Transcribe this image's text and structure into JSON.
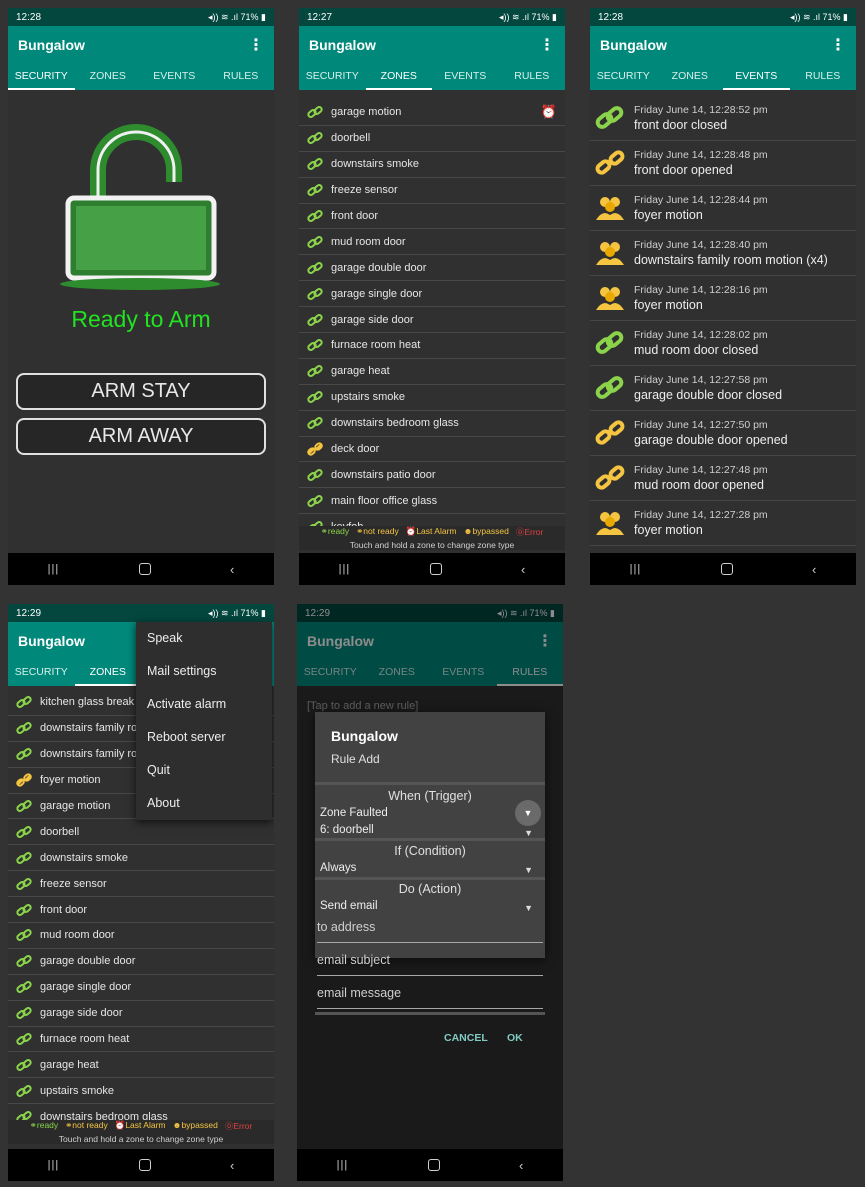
{
  "app_title": "Bungalow",
  "tabs": [
    "SECURITY",
    "ZONES",
    "EVENTS",
    "RULES"
  ],
  "screen1": {
    "time": "12:28",
    "battery": "71%",
    "status": "Ready to Arm",
    "arm_stay": "ARM STAY",
    "arm_away": "ARM AWAY"
  },
  "screen2": {
    "time": "12:27",
    "battery": "71%",
    "zones": [
      {
        "name": "garage motion",
        "state": "ready",
        "alarm": true
      },
      {
        "name": "doorbell",
        "state": "ready"
      },
      {
        "name": "downstairs smoke",
        "state": "ready"
      },
      {
        "name": "freeze sensor",
        "state": "ready"
      },
      {
        "name": "front door",
        "state": "ready"
      },
      {
        "name": "mud room door",
        "state": "ready"
      },
      {
        "name": "garage double door",
        "state": "ready"
      },
      {
        "name": "garage single door",
        "state": "ready"
      },
      {
        "name": "garage side door",
        "state": "ready"
      },
      {
        "name": "furnace room heat",
        "state": "ready"
      },
      {
        "name": "garage heat",
        "state": "ready"
      },
      {
        "name": "upstairs smoke",
        "state": "ready"
      },
      {
        "name": "downstairs bedroom glass",
        "state": "ready"
      },
      {
        "name": "deck door",
        "state": "not_ready"
      },
      {
        "name": "downstairs patio door",
        "state": "ready"
      },
      {
        "name": "main floor office glass",
        "state": "ready"
      },
      {
        "name": "keyfob",
        "state": "ready"
      }
    ]
  },
  "legend": {
    "ready": "ready",
    "not_ready": "not ready",
    "last_alarm": "Last Alarm",
    "bypassed": "bypassed",
    "error": "Error",
    "hint": "Touch and hold a zone to change zone type"
  },
  "screen3": {
    "time": "12:28",
    "battery": "71%",
    "events": [
      {
        "time": "Friday June 14, 12:28:52 pm",
        "text": "front door closed",
        "icon": "link-green"
      },
      {
        "time": "Friday June 14, 12:28:48 pm",
        "text": "front door opened",
        "icon": "link-broken-yellow"
      },
      {
        "time": "Friday June 14, 12:28:44 pm",
        "text": "foyer motion",
        "icon": "people-yellow"
      },
      {
        "time": "Friday June 14, 12:28:40 pm",
        "text": "downstairs family room motion (x4)",
        "icon": "people-yellow"
      },
      {
        "time": "Friday June 14, 12:28:16 pm",
        "text": "foyer motion",
        "icon": "people-yellow"
      },
      {
        "time": "Friday June 14, 12:28:02 pm",
        "text": "mud room door closed",
        "icon": "link-green"
      },
      {
        "time": "Friday June 14, 12:27:58 pm",
        "text": "garage double door closed",
        "icon": "link-green"
      },
      {
        "time": "Friday June 14, 12:27:50 pm",
        "text": "garage double door opened",
        "icon": "link-broken-yellow"
      },
      {
        "time": "Friday June 14, 12:27:48 pm",
        "text": "mud room door opened",
        "icon": "link-broken-yellow"
      },
      {
        "time": "Friday June 14, 12:27:28 pm",
        "text": "foyer motion",
        "icon": "people-yellow"
      }
    ]
  },
  "screen4": {
    "time": "12:29",
    "battery": "71%",
    "menu": [
      "Speak",
      "Mail settings",
      "Activate alarm",
      "Reboot server",
      "Quit",
      "About"
    ],
    "zones": [
      {
        "name": "kitchen glass break",
        "state": "ready"
      },
      {
        "name": "downstairs family ro",
        "state": "ready"
      },
      {
        "name": "downstairs family ro",
        "state": "ready"
      },
      {
        "name": "foyer motion",
        "state": "not_ready"
      },
      {
        "name": "garage motion",
        "state": "ready"
      },
      {
        "name": "doorbell",
        "state": "ready"
      },
      {
        "name": "downstairs smoke",
        "state": "ready"
      },
      {
        "name": "freeze sensor",
        "state": "ready"
      },
      {
        "name": "front door",
        "state": "ready"
      },
      {
        "name": "mud room door",
        "state": "ready"
      },
      {
        "name": "garage double door",
        "state": "ready"
      },
      {
        "name": "garage single door",
        "state": "ready"
      },
      {
        "name": "garage side door",
        "state": "ready"
      },
      {
        "name": "furnace room heat",
        "state": "ready"
      },
      {
        "name": "garage heat",
        "state": "ready"
      },
      {
        "name": "upstairs smoke",
        "state": "ready"
      },
      {
        "name": "downstairs bedroom glass",
        "state": "ready"
      }
    ]
  },
  "screen5": {
    "time": "12:29",
    "battery": "71%",
    "background_hint": "[Tap to add a new rule]",
    "dialog": {
      "title": "Bungalow",
      "subtitle": "Rule Add",
      "when_label": "When (Trigger)",
      "when_value1": "Zone Faulted",
      "when_value2": "6: doorbell",
      "if_label": "If (Condition)",
      "if_value": "Always",
      "do_label": "Do (Action)",
      "do_value": "Send email",
      "to_placeholder": "to address",
      "subject_placeholder": "email subject",
      "message_placeholder": "email message",
      "cancel": "CANCEL",
      "ok": "OK"
    }
  },
  "colors": {
    "appbar": "#00897b",
    "ready_green": "#22e222",
    "icon_green": "#8ad34a",
    "icon_yellow": "#f5c542"
  }
}
